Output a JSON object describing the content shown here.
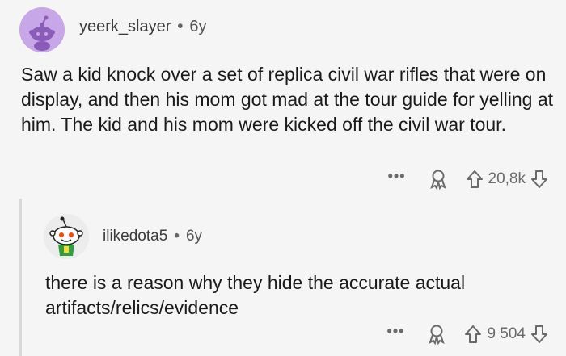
{
  "comments": [
    {
      "author": "yeerk_slayer",
      "separator": "•",
      "age": "6y",
      "text": "Saw a kid knock over a set of replica civil war rifles that were on display, and then his mom got mad at the tour guide for yelling at him. The kid and his mom were kicked off the civil war tour.",
      "score": "20,8k",
      "avatar_color": "#c8a7e8"
    },
    {
      "author": "ilikedota5",
      "separator": "•",
      "age": "6y",
      "text": "there is a reason why they hide the accurate actual artifacts/relics/evidence",
      "score": "9 504",
      "avatar_color": "#e6e6e6"
    }
  ],
  "actions": {
    "more_label": "•••",
    "award_icon": "award-icon",
    "upvote_icon": "upvote-arrow-icon",
    "downvote_icon": "downvote-arrow-icon"
  }
}
